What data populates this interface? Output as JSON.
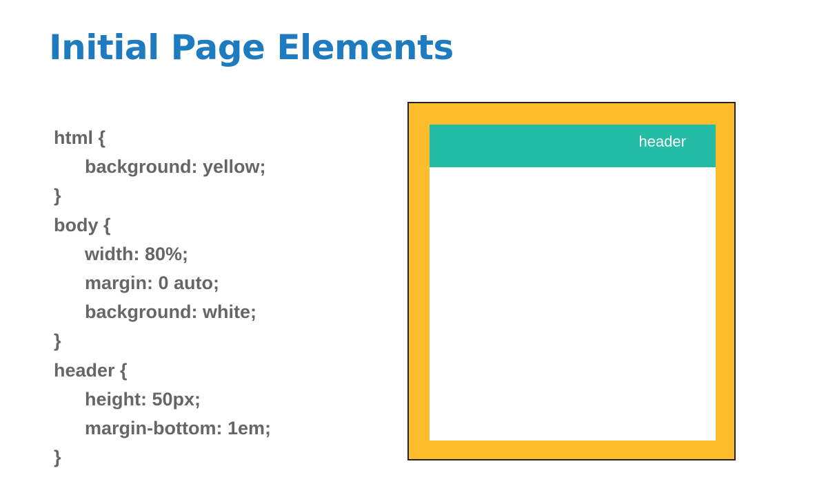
{
  "slide": {
    "title": "Initial Page Elements",
    "title_color": "#1f7bbf",
    "code_color": "#666666"
  },
  "code_lines": [
    {
      "text": "html {",
      "indent": 0
    },
    {
      "text": "background: yellow;",
      "indent": 1
    },
    {
      "text": "}",
      "indent": 0
    },
    {
      "text": "body {",
      "indent": 0
    },
    {
      "text": "width: 80%;",
      "indent": 1
    },
    {
      "text": "margin: 0 auto;",
      "indent": 1
    },
    {
      "text": "background: white;",
      "indent": 1
    },
    {
      "text": "}",
      "indent": 0
    },
    {
      "text": "header {",
      "indent": 0
    },
    {
      "text": "height: 50px;",
      "indent": 1
    },
    {
      "text": "margin-bottom: 1em;",
      "indent": 1
    },
    {
      "text": "}",
      "indent": 0
    }
  ],
  "diagram": {
    "html_color": "#fdbd2b",
    "body_color": "#ffffff",
    "header_color": "#25bca6",
    "header_label": "header"
  }
}
